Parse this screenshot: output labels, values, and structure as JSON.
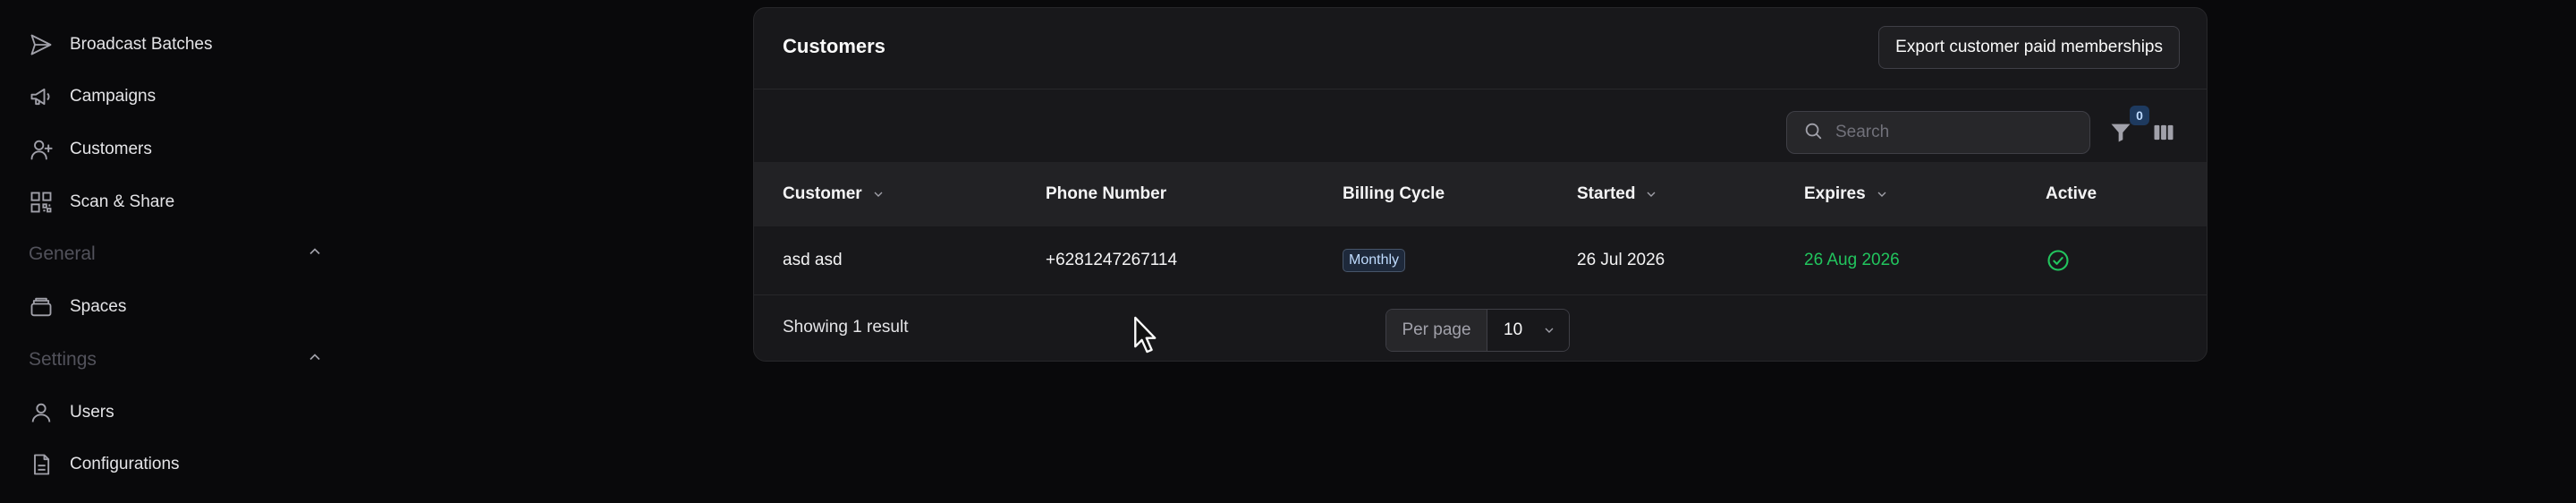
{
  "sidebar": {
    "items_top": [
      {
        "label": "Broadcast Batches",
        "icon": "send-icon"
      },
      {
        "label": "Campaigns",
        "icon": "megaphone-icon"
      },
      {
        "label": "Customers",
        "icon": "user-plus-icon"
      },
      {
        "label": "Scan & Share",
        "icon": "qr-code-icon"
      }
    ],
    "general": {
      "label": "General",
      "items": [
        {
          "label": "Spaces",
          "icon": "layers-icon"
        }
      ]
    },
    "settings": {
      "label": "Settings",
      "items": [
        {
          "label": "Users",
          "icon": "user-icon"
        },
        {
          "label": "Configurations",
          "icon": "file-text-icon"
        }
      ]
    }
  },
  "panel": {
    "title": "Customers",
    "export_label": "Export customer paid memberships",
    "search_placeholder": "Search",
    "filter_count": "0"
  },
  "table": {
    "headers": [
      "Customer",
      "Phone Number",
      "Billing Cycle",
      "Started",
      "Expires",
      "Active"
    ],
    "rows": [
      {
        "customer": "asd asd",
        "phone": "+6281247267114",
        "billing_cycle": "Monthly",
        "started": "26 Jul 2026",
        "expires": "26 Aug 2026",
        "active": true
      }
    ]
  },
  "footer": {
    "result_text": "Showing 1 result",
    "per_page_label": "Per page",
    "per_page_value": "10"
  },
  "colors": {
    "background": "#09090b",
    "panel": "#18181b",
    "expires_green": "#22c55e",
    "badge_blue": "#1e3a5f"
  }
}
